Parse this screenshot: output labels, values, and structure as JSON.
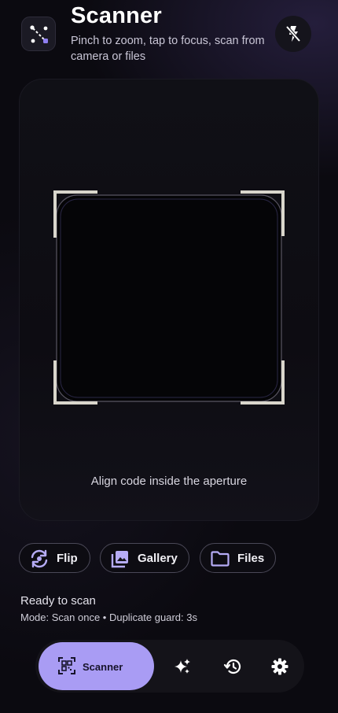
{
  "header": {
    "title": "Scanner",
    "subtitle": "Pinch to zoom, tap to focus, scan from camera or files",
    "app_icon": "scan-path-icon",
    "flash_icon": "flash-off-icon"
  },
  "viewfinder": {
    "hint": "Align code inside the aperture",
    "accent_color": "#8f7ff0"
  },
  "actions": [
    {
      "label": "Flip",
      "icon": "flip-camera-icon"
    },
    {
      "label": "Gallery",
      "icon": "gallery-icon"
    },
    {
      "label": "Files",
      "icon": "folder-icon"
    }
  ],
  "status": {
    "state": "Ready to scan",
    "mode": "Mode: Scan once • Duplicate guard: 3s"
  },
  "nav": {
    "active_label": "Scanner",
    "active_icon": "qr-scan-icon",
    "items": [
      {
        "icon": "sparkle-icon"
      },
      {
        "icon": "history-icon"
      },
      {
        "icon": "settings-icon"
      }
    ],
    "active_color": "#a99cf4"
  }
}
